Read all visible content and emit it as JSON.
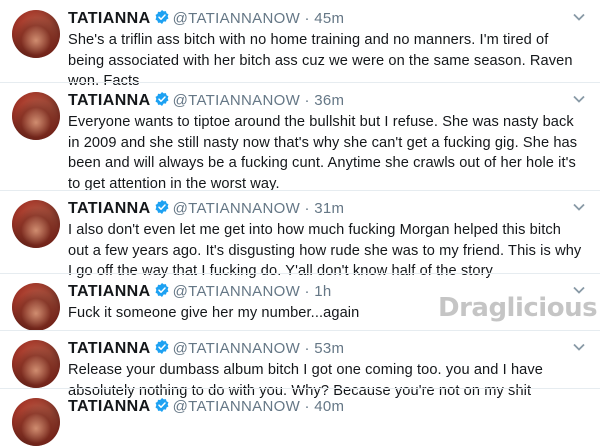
{
  "tweets": [
    {
      "name": "TATIANNA",
      "handle": "@TATIANNANOW",
      "time": "· 45m",
      "lines": [
        "She's a triflin ass bitch with no home training and no manners. I'm tired of",
        "being associated with her bitch ass cuz we were on the same season. Raven",
        "won. Facts"
      ]
    },
    {
      "name": "TATIANNA",
      "handle": "@TATIANNANOW",
      "time": "· 36m",
      "lines": [
        "Everyone wants to tiptoe around the bullshit but I refuse. She was nasty back",
        "in 2009 and she still nasty now that's why she can't get a fucking gig. She has",
        "been and will always be a fucking cunt.  Anytime she crawls out of her hole it's",
        "to get attention in the worst way."
      ]
    },
    {
      "name": "TATIANNA",
      "handle": "@TATIANNANOW",
      "time": "· 31m",
      "lines": [
        "I also don't even let me get into how much fucking Morgan helped this bitch",
        "out a few years ago. It's disgusting how rude she was to my friend. This is why",
        "I go off the way that I fucking do. Y'all don't know half of the story"
      ]
    },
    {
      "name": "TATIANNA",
      "handle": "@TATIANNANOW",
      "time": "· 1h",
      "lines": [
        "Fuck it someone give her my number...again"
      ]
    },
    {
      "name": "TATIANNA",
      "handle": "@TATIANNANOW",
      "time": "· 53m",
      "lines": [
        "Release your dumbass album bitch I got one coming too. you and I have",
        "absolutely nothing to do with you. Why? Because you're not on my shit"
      ]
    },
    {
      "name": "TATIANNA",
      "handle": "@TATIANNANOW",
      "time": "· 40m",
      "lines": []
    }
  ],
  "watermark": "Draglicious",
  "icons": {
    "verified": "verified-badge-icon",
    "caret": "chevron-down-icon",
    "avatar": "profile-avatar"
  },
  "colors": {
    "verified": "#1da1f2",
    "handle": "#657786",
    "text": "#14171a"
  }
}
